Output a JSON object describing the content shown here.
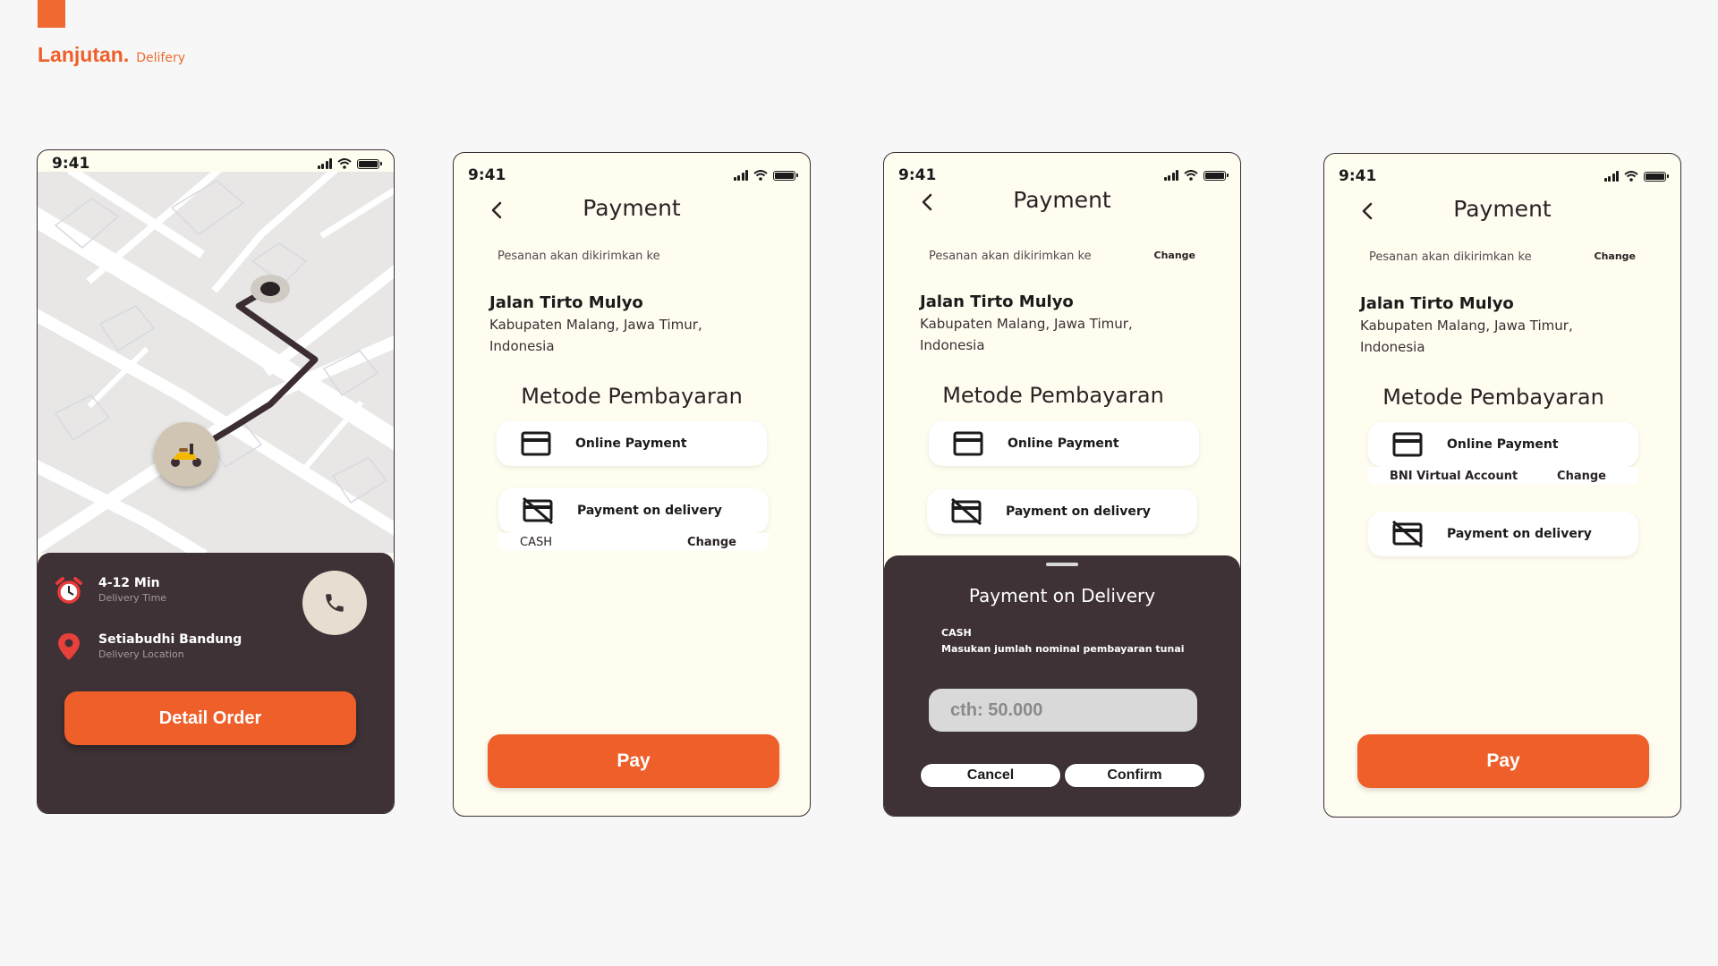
{
  "brand": {
    "title": "Lanjutan.",
    "subtitle": "Delifery",
    "accent": "#ee5f2a"
  },
  "colors": {
    "dark_panel": "#3e3236",
    "screen_bg": "#fffdf0",
    "primary": "#ee5f2a"
  },
  "screens": [
    {
      "status_time": "9:41",
      "info": {
        "time_main": "4-12 Min",
        "time_sub": "Delivery Time",
        "loc_main": "Setiabudhi Bandung",
        "loc_sub": "Delivery  Location"
      },
      "detail_button": "Detail Order",
      "icons": [
        "alarm-clock-icon",
        "location-pin-icon",
        "phone-icon",
        "scooter-icon"
      ]
    },
    {
      "status_time": "9:41",
      "title": "Payment",
      "deliver_label": "Pesanan akan dikirimkan ke",
      "address_name": "Jalan Tirto Mulyo",
      "address_line1": "Kabupaten Malang, Jawa Timur,",
      "address_line2": "Indonesia",
      "method_title": "Metode Pembayaran",
      "option_online": "Online Payment",
      "option_delivery": "Payment on delivery",
      "delivery_sub_left": "CASH",
      "delivery_sub_right": "Change",
      "pay_button": "Pay"
    },
    {
      "status_time": "9:41",
      "title": "Payment",
      "deliver_label": "Pesanan akan dikirimkan ke",
      "change": "Change",
      "address_name": "Jalan Tirto Mulyo",
      "address_line1": "Kabupaten Malang, Jawa Timur,",
      "address_line2": "Indonesia",
      "method_title": "Metode Pembayaran",
      "option_online": "Online Payment",
      "option_delivery": "Payment on delivery",
      "sheet": {
        "title": "Payment on Delivery",
        "cash_label": "CASH",
        "hint": "Masukan jumlah nominal pembayaran tunai",
        "input_placeholder": "cth: 50.000",
        "input_value": "",
        "cancel": "Cancel",
        "confirm": "Confirm"
      }
    },
    {
      "status_time": "9:41",
      "title": "Payment",
      "deliver_label": "Pesanan akan dikirimkan ke",
      "change": "Change",
      "address_name": "Jalan Tirto Mulyo",
      "address_line1": "Kabupaten Malang, Jawa Timur,",
      "address_line2": "Indonesia",
      "method_title": "Metode Pembayaran",
      "option_online": "Online Payment",
      "online_sub_left": "BNI Virtual Account",
      "online_sub_right": "Change",
      "option_delivery": "Payment on delivery",
      "pay_button": "Pay"
    }
  ]
}
